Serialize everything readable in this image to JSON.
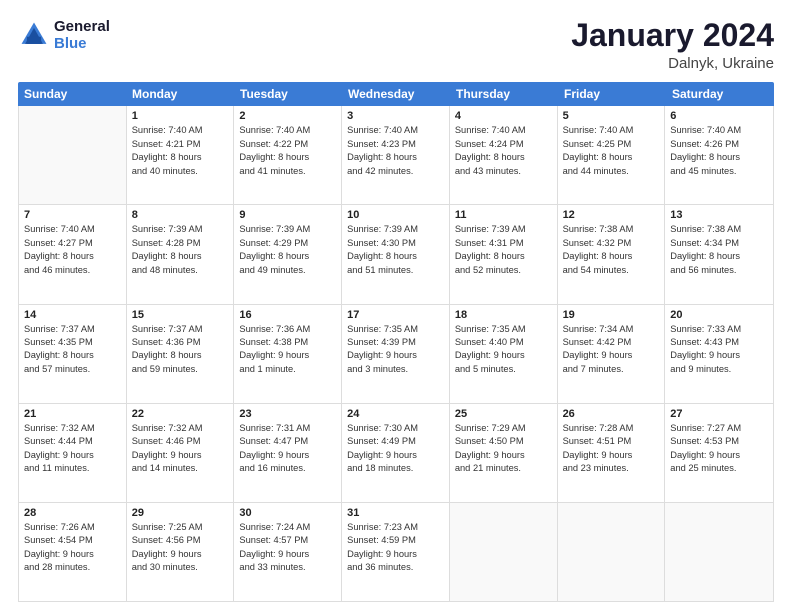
{
  "logo": {
    "line1": "General",
    "line2": "Blue"
  },
  "title": "January 2024",
  "subtitle": "Dalnyk, Ukraine",
  "header_days": [
    "Sunday",
    "Monday",
    "Tuesday",
    "Wednesday",
    "Thursday",
    "Friday",
    "Saturday"
  ],
  "weeks": [
    [
      {
        "day": "",
        "lines": []
      },
      {
        "day": "1",
        "lines": [
          "Sunrise: 7:40 AM",
          "Sunset: 4:21 PM",
          "Daylight: 8 hours",
          "and 40 minutes."
        ]
      },
      {
        "day": "2",
        "lines": [
          "Sunrise: 7:40 AM",
          "Sunset: 4:22 PM",
          "Daylight: 8 hours",
          "and 41 minutes."
        ]
      },
      {
        "day": "3",
        "lines": [
          "Sunrise: 7:40 AM",
          "Sunset: 4:23 PM",
          "Daylight: 8 hours",
          "and 42 minutes."
        ]
      },
      {
        "day": "4",
        "lines": [
          "Sunrise: 7:40 AM",
          "Sunset: 4:24 PM",
          "Daylight: 8 hours",
          "and 43 minutes."
        ]
      },
      {
        "day": "5",
        "lines": [
          "Sunrise: 7:40 AM",
          "Sunset: 4:25 PM",
          "Daylight: 8 hours",
          "and 44 minutes."
        ]
      },
      {
        "day": "6",
        "lines": [
          "Sunrise: 7:40 AM",
          "Sunset: 4:26 PM",
          "Daylight: 8 hours",
          "and 45 minutes."
        ]
      }
    ],
    [
      {
        "day": "7",
        "lines": [
          "Sunrise: 7:40 AM",
          "Sunset: 4:27 PM",
          "Daylight: 8 hours",
          "and 46 minutes."
        ]
      },
      {
        "day": "8",
        "lines": [
          "Sunrise: 7:39 AM",
          "Sunset: 4:28 PM",
          "Daylight: 8 hours",
          "and 48 minutes."
        ]
      },
      {
        "day": "9",
        "lines": [
          "Sunrise: 7:39 AM",
          "Sunset: 4:29 PM",
          "Daylight: 8 hours",
          "and 49 minutes."
        ]
      },
      {
        "day": "10",
        "lines": [
          "Sunrise: 7:39 AM",
          "Sunset: 4:30 PM",
          "Daylight: 8 hours",
          "and 51 minutes."
        ]
      },
      {
        "day": "11",
        "lines": [
          "Sunrise: 7:39 AM",
          "Sunset: 4:31 PM",
          "Daylight: 8 hours",
          "and 52 minutes."
        ]
      },
      {
        "day": "12",
        "lines": [
          "Sunrise: 7:38 AM",
          "Sunset: 4:32 PM",
          "Daylight: 8 hours",
          "and 54 minutes."
        ]
      },
      {
        "day": "13",
        "lines": [
          "Sunrise: 7:38 AM",
          "Sunset: 4:34 PM",
          "Daylight: 8 hours",
          "and 56 minutes."
        ]
      }
    ],
    [
      {
        "day": "14",
        "lines": [
          "Sunrise: 7:37 AM",
          "Sunset: 4:35 PM",
          "Daylight: 8 hours",
          "and 57 minutes."
        ]
      },
      {
        "day": "15",
        "lines": [
          "Sunrise: 7:37 AM",
          "Sunset: 4:36 PM",
          "Daylight: 8 hours",
          "and 59 minutes."
        ]
      },
      {
        "day": "16",
        "lines": [
          "Sunrise: 7:36 AM",
          "Sunset: 4:38 PM",
          "Daylight: 9 hours",
          "and 1 minute."
        ]
      },
      {
        "day": "17",
        "lines": [
          "Sunrise: 7:35 AM",
          "Sunset: 4:39 PM",
          "Daylight: 9 hours",
          "and 3 minutes."
        ]
      },
      {
        "day": "18",
        "lines": [
          "Sunrise: 7:35 AM",
          "Sunset: 4:40 PM",
          "Daylight: 9 hours",
          "and 5 minutes."
        ]
      },
      {
        "day": "19",
        "lines": [
          "Sunrise: 7:34 AM",
          "Sunset: 4:42 PM",
          "Daylight: 9 hours",
          "and 7 minutes."
        ]
      },
      {
        "day": "20",
        "lines": [
          "Sunrise: 7:33 AM",
          "Sunset: 4:43 PM",
          "Daylight: 9 hours",
          "and 9 minutes."
        ]
      }
    ],
    [
      {
        "day": "21",
        "lines": [
          "Sunrise: 7:32 AM",
          "Sunset: 4:44 PM",
          "Daylight: 9 hours",
          "and 11 minutes."
        ]
      },
      {
        "day": "22",
        "lines": [
          "Sunrise: 7:32 AM",
          "Sunset: 4:46 PM",
          "Daylight: 9 hours",
          "and 14 minutes."
        ]
      },
      {
        "day": "23",
        "lines": [
          "Sunrise: 7:31 AM",
          "Sunset: 4:47 PM",
          "Daylight: 9 hours",
          "and 16 minutes."
        ]
      },
      {
        "day": "24",
        "lines": [
          "Sunrise: 7:30 AM",
          "Sunset: 4:49 PM",
          "Daylight: 9 hours",
          "and 18 minutes."
        ]
      },
      {
        "day": "25",
        "lines": [
          "Sunrise: 7:29 AM",
          "Sunset: 4:50 PM",
          "Daylight: 9 hours",
          "and 21 minutes."
        ]
      },
      {
        "day": "26",
        "lines": [
          "Sunrise: 7:28 AM",
          "Sunset: 4:51 PM",
          "Daylight: 9 hours",
          "and 23 minutes."
        ]
      },
      {
        "day": "27",
        "lines": [
          "Sunrise: 7:27 AM",
          "Sunset: 4:53 PM",
          "Daylight: 9 hours",
          "and 25 minutes."
        ]
      }
    ],
    [
      {
        "day": "28",
        "lines": [
          "Sunrise: 7:26 AM",
          "Sunset: 4:54 PM",
          "Daylight: 9 hours",
          "and 28 minutes."
        ]
      },
      {
        "day": "29",
        "lines": [
          "Sunrise: 7:25 AM",
          "Sunset: 4:56 PM",
          "Daylight: 9 hours",
          "and 30 minutes."
        ]
      },
      {
        "day": "30",
        "lines": [
          "Sunrise: 7:24 AM",
          "Sunset: 4:57 PM",
          "Daylight: 9 hours",
          "and 33 minutes."
        ]
      },
      {
        "day": "31",
        "lines": [
          "Sunrise: 7:23 AM",
          "Sunset: 4:59 PM",
          "Daylight: 9 hours",
          "and 36 minutes."
        ]
      },
      {
        "day": "",
        "lines": []
      },
      {
        "day": "",
        "lines": []
      },
      {
        "day": "",
        "lines": []
      }
    ]
  ]
}
